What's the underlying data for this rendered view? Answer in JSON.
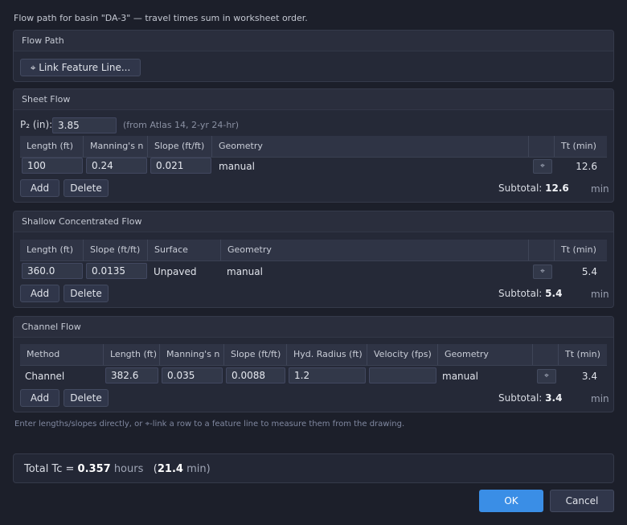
{
  "intro": "Flow path for basin \"DA-3\" — travel times sum in worksheet order.",
  "flow_path": {
    "title": "Flow Path",
    "link_button": "⌖ Link Feature Line..."
  },
  "sheet_flow": {
    "title": "Sheet Flow",
    "p2_label": "P₂ (in):",
    "p2_value": "3.85",
    "p2_note": "(from Atlas 14, 2-yr 24-hr)",
    "columns": [
      "Length (ft)",
      "Manning's n",
      "Slope (ft/ft)",
      "Geometry",
      "",
      "Tt (min)"
    ],
    "row": {
      "length": "100",
      "n": "0.24",
      "slope": "0.021",
      "geometry": "manual",
      "tt": "12.6"
    },
    "add": "Add",
    "delete": "Delete",
    "subtotal_label": "Subtotal:",
    "subtotal_value": "12.6",
    "unit": "min"
  },
  "shallow_flow": {
    "title": "Shallow Concentrated Flow",
    "columns": [
      "Length (ft)",
      "Slope (ft/ft)",
      "Surface",
      "Geometry",
      "",
      "Tt (min)"
    ],
    "row": {
      "length": "360.0",
      "slope": "0.0135",
      "surface": "Unpaved",
      "geometry": "manual",
      "tt": "5.4"
    },
    "add": "Add",
    "delete": "Delete",
    "subtotal_label": "Subtotal:",
    "subtotal_value": "5.4",
    "unit": "min"
  },
  "channel_flow": {
    "title": "Channel Flow",
    "columns": [
      "Method",
      "Length (ft)",
      "Manning's n",
      "Slope (ft/ft)",
      "Hyd. Radius (ft)",
      "Velocity (fps)",
      "Geometry",
      "",
      "Tt (min)"
    ],
    "row": {
      "method": "Channel",
      "length": "382.6",
      "n": "0.035",
      "slope": "0.0088",
      "radius": "1.2",
      "velocity": "",
      "geometry": "manual",
      "tt": "3.4"
    },
    "add": "Add",
    "delete": "Delete",
    "subtotal_label": "Subtotal:",
    "subtotal_value": "3.4",
    "unit": "min"
  },
  "hint": "Enter lengths/slopes directly, or ⌖-link a row to a feature line to measure them from the drawing.",
  "total": {
    "label": "Total Tc =",
    "hours_value": "0.357",
    "hours_unit": "hours",
    "open_paren": "(",
    "min_value": "21.4",
    "min_unit": "min)"
  },
  "actions": {
    "ok": "OK",
    "cancel": "Cancel"
  },
  "icons": {
    "link": "crosshair-link-icon"
  },
  "colors": {
    "accent": "#3a8ee6",
    "background": "#1c1f2a",
    "panel": "#252937"
  }
}
